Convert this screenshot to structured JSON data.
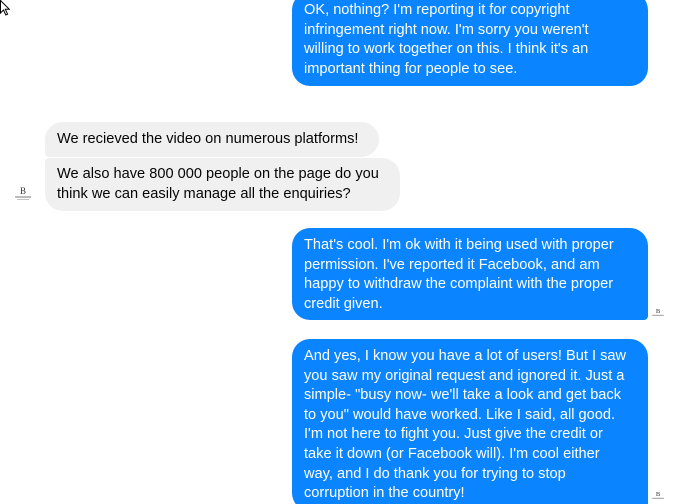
{
  "conversation": {
    "messages": [
      {
        "sender": "me",
        "text": "OK, nothing? I'm reporting it for copyright\ninfringement right now. I'm sorry you weren't\nwilling to work together on this. I think it's an\nimportant thing for people to see."
      },
      {
        "sender": "page",
        "text": "We recieved the video on numerous platforms!"
      },
      {
        "sender": "page",
        "text": "We also have 800 000 people on the page do you\nthink we can easily manage all the enquiries?"
      },
      {
        "sender": "me",
        "text": "That's cool. I'm ok with it being used with proper\npermission. I've reported it Facebook, and am\nhappy to withdraw the complaint with the proper\ncredit given."
      },
      {
        "sender": "me",
        "text": "And yes, I know you have a lot of users! But I saw\nyou saw my original request and ignored it. Just a\nsimple- \"busy now- we'll take a look and get back\nto you\" would have worked. Like I said, all good.\nI'm not here to fight you. Just give the credit or\ntake it down (or Facebook will). I'm cool either\nway, and I do thank you for trying to stop\ncorruption in the country!"
      }
    ]
  },
  "colors": {
    "outgoing_bubble": "#0a84ff",
    "incoming_bubble": "#f1f0f0"
  },
  "icons": {
    "cursor": "mouse-cursor-icon",
    "avatar": "page-logo-avatar"
  }
}
